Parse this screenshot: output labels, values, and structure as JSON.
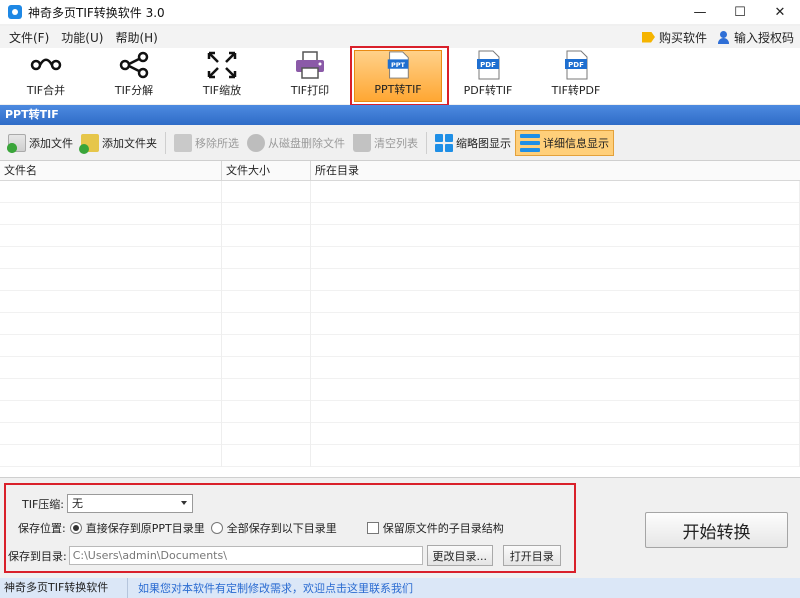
{
  "window": {
    "title": "神奇多页TIF转换软件 3.0",
    "controls": [
      "—",
      "☐",
      "✕"
    ]
  },
  "menu": {
    "items": [
      "文件(F)",
      "功能(U)",
      "帮助(H)"
    ],
    "buy": "购买软件",
    "license": "输入授权码"
  },
  "toolbar": {
    "tools": [
      {
        "label": "TIF合并",
        "icon": "merge-icon"
      },
      {
        "label": "TIF分解",
        "icon": "split-icon"
      },
      {
        "label": "TIF缩放",
        "icon": "resize-icon"
      },
      {
        "label": "TIF打印",
        "icon": "printer-icon"
      },
      {
        "label": "PPT转TIF",
        "icon": "ppt-file-icon",
        "badge": "PPT"
      },
      {
        "label": "PDF转TIF",
        "icon": "pdf-file-icon",
        "badge": "PDF"
      },
      {
        "label": "TIF转PDF",
        "icon": "pdf-file-icon",
        "badge": "PDF"
      }
    ],
    "active_index": 4
  },
  "section": {
    "title": "PPT转TIF"
  },
  "actions": {
    "add_file": "添加文件",
    "add_folder": "添加文件夹",
    "remove_selected": "移除所选",
    "delete_from_disk": "从磁盘删除文件",
    "clear_list": "清空列表",
    "thumbnail_view": "缩略图显示",
    "detail_view": "详细信息显示"
  },
  "filelist": {
    "columns": [
      "文件名",
      "文件大小",
      "所在目录"
    ],
    "rows": []
  },
  "options": {
    "compression_label": "TIF压缩:",
    "compression_value": "无",
    "location_label": "保存位置:",
    "radio_original": "直接保存到原PPT目录里",
    "radio_all": "全部保存到以下目录里",
    "keep_structure": "保留原文件的子目录结构",
    "save_dir_label": "保存到目录:",
    "save_dir_value": "C:\\Users\\admin\\Documents\\",
    "change_dir": "更改目录...",
    "open_dir": "打开目录"
  },
  "start_button": "开始转换",
  "status": {
    "app": "神奇多页TIF转换软件 3.0",
    "link": "如果您对本软件有定制修改需求，欢迎点击这里联系我们"
  },
  "colors": {
    "accent": "#2f6cc7",
    "highlight": "#d9202a",
    "active_tool": "#ffa733",
    "link": "#2a6bd1"
  }
}
